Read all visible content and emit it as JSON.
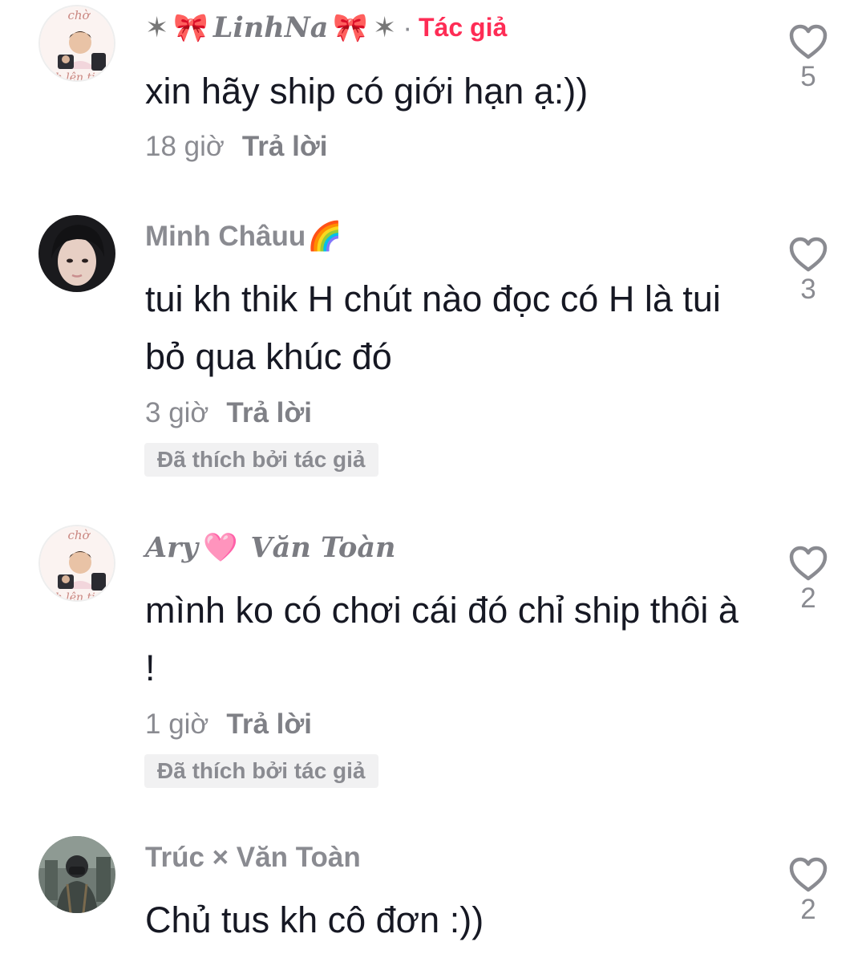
{
  "comments": [
    {
      "username_parts": [
        "✶ ",
        "🎀",
        " LinhNa ",
        "🎀",
        " ✶"
      ],
      "author_sep": "·",
      "author_tag": "Tác giả",
      "text": "xin hãy ship có giới hạn ạ:))",
      "time": "18 giờ",
      "reply": "Trả lời",
      "badge": "",
      "likes": "5",
      "avatar_caption_top": "chờ",
      "avatar_caption_bottom": "nh lên tiến"
    },
    {
      "username": "Minh Châuu",
      "username_emoji": "🌈",
      "text": "tui kh thik H chút nào đọc có H là tui bỏ qua khúc đó",
      "time": "3 giờ",
      "reply": "Trả lời",
      "badge": "Đã thích bởi tác giả",
      "likes": "3"
    },
    {
      "username_left": "Ary",
      "username_emoji": "🩷",
      "username_right": "Văn Toàn",
      "text": "mình ko có chơi cái đó chỉ ship thôi à !",
      "time": "1 giờ",
      "reply": "Trả lời",
      "badge": "Đã thích bởi tác giả",
      "likes": "2",
      "avatar_caption_top": "chờ",
      "avatar_caption_bottom": "nh lên tiến"
    },
    {
      "username": "Trúc × Văn Toàn",
      "text": "Chủ tus kh cô đơn :))",
      "likes": "2"
    }
  ],
  "colors": {
    "text": "#161823",
    "muted": "#8a8b91",
    "author_accent": "#fe2c55",
    "badge_bg": "#f1f1f2"
  },
  "icons": {
    "like": "heart-outline-icon"
  }
}
